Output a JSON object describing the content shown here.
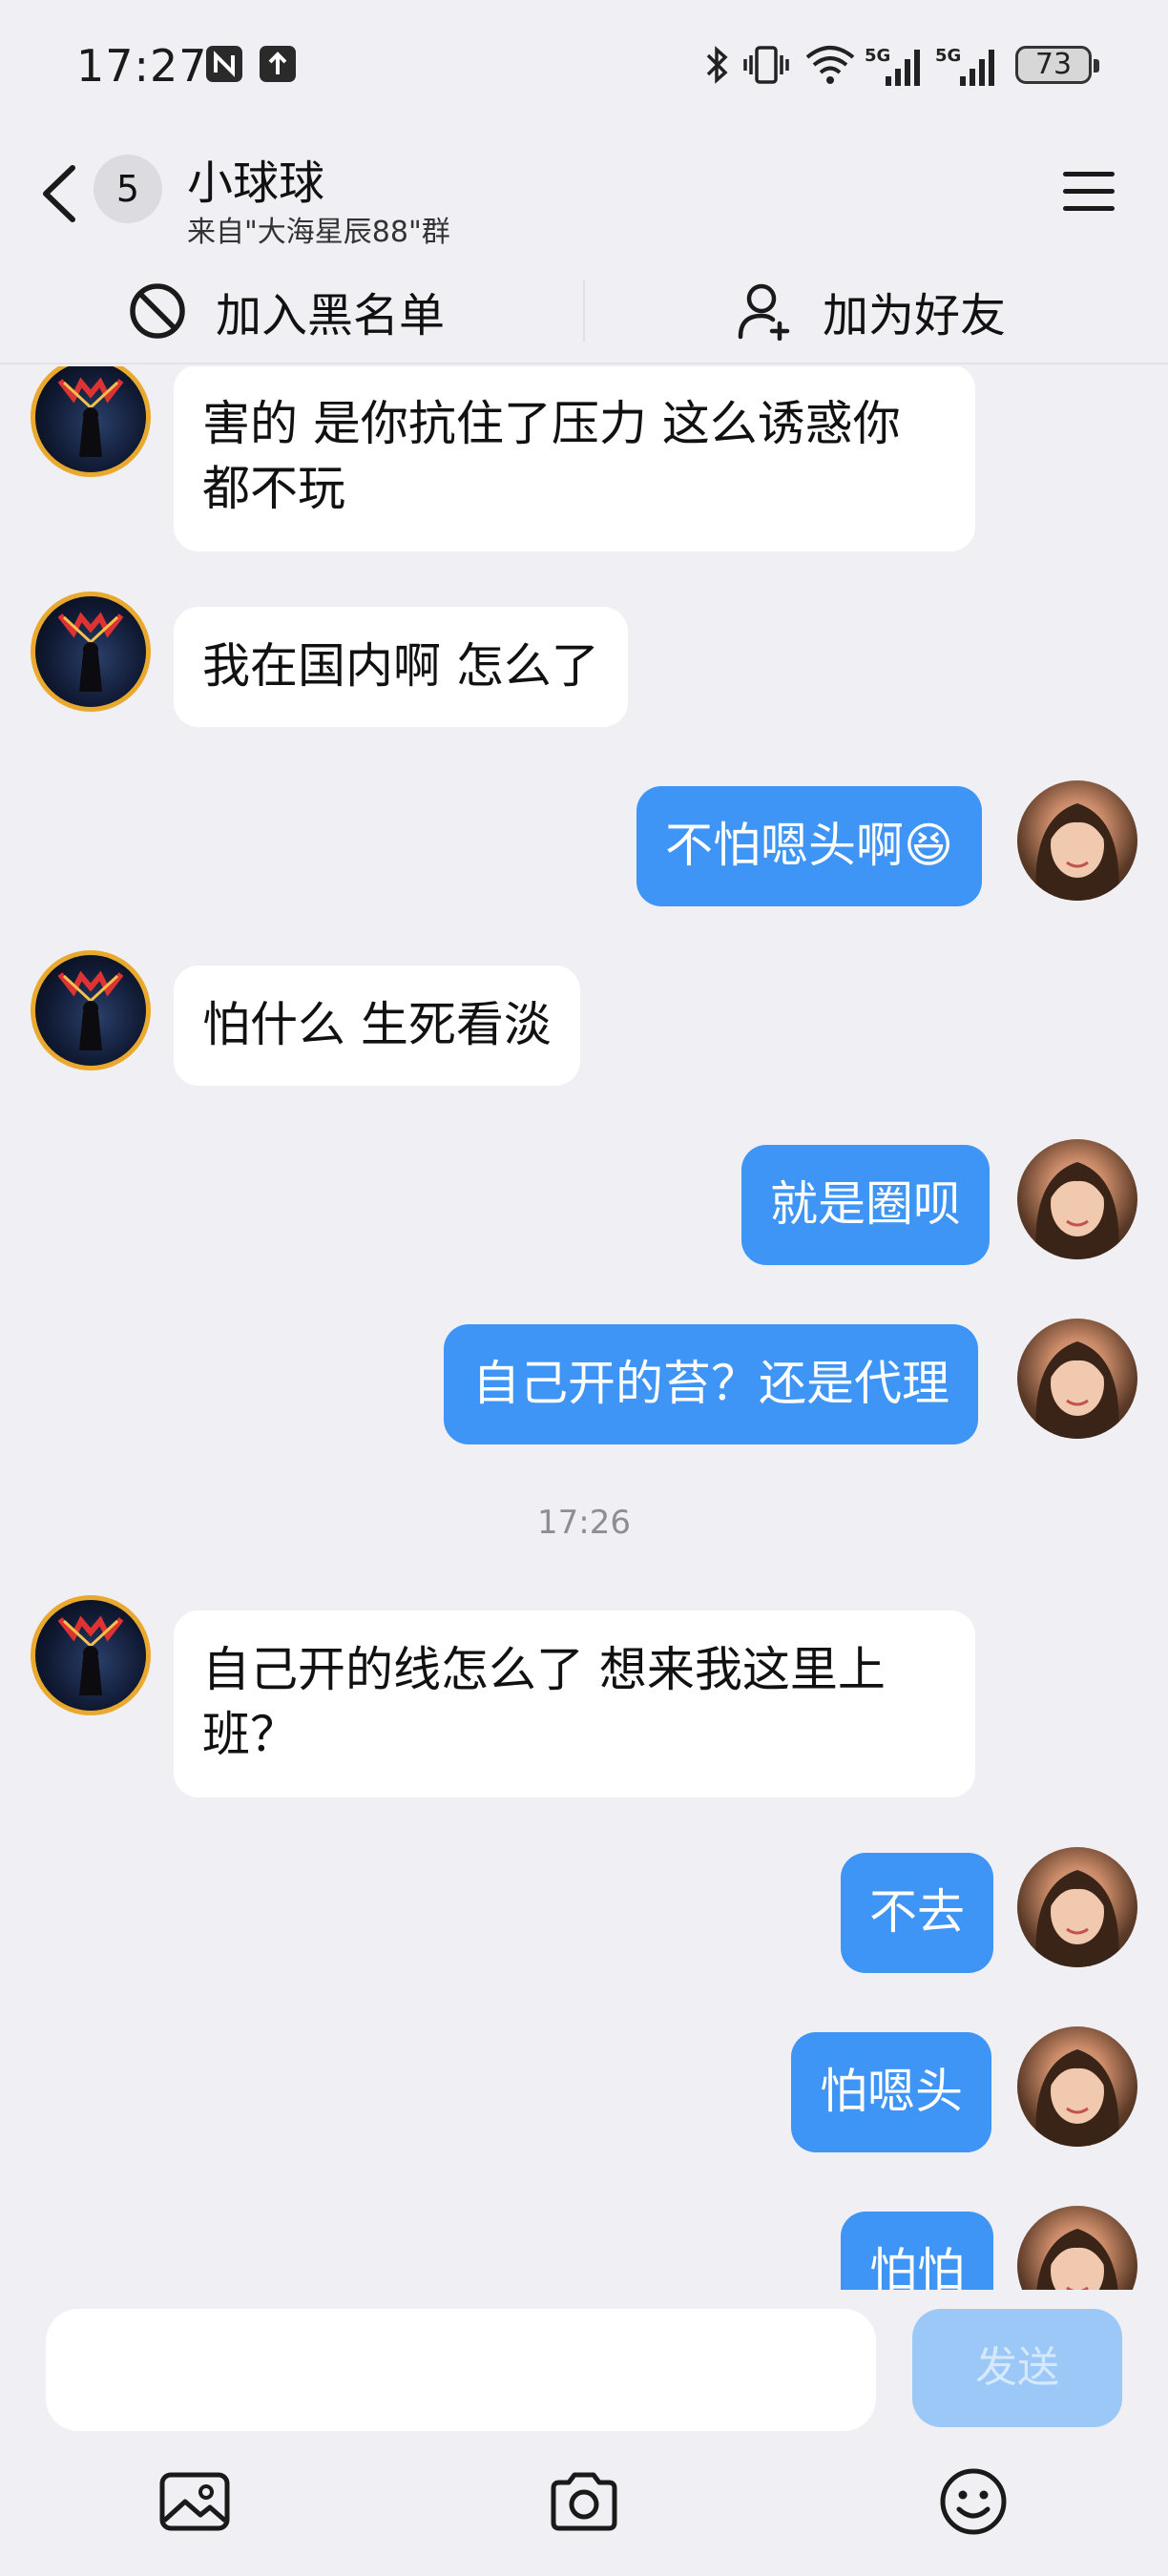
{
  "status_bar": {
    "time": "17:27",
    "battery": "73",
    "icons": [
      "nfc-icon",
      "upload-icon",
      "bluetooth-icon",
      "vibrate-icon",
      "wifi-icon",
      "signal-5g-icon",
      "signal-5g-icon"
    ]
  },
  "header": {
    "unread_count": "5",
    "contact_name": "小球球",
    "subtitle": "来自\"大海星辰88\"群"
  },
  "actions": {
    "block_label": "加入黑名单",
    "add_friend_label": "加为好友"
  },
  "messages": [
    {
      "side": "in",
      "text": "害的 是你抗住了压力 这么诱惑你都不玩"
    },
    {
      "side": "in",
      "text": "我在国内啊 怎么了"
    },
    {
      "side": "out",
      "text": "不怕嗯头啊",
      "emoji": "😆"
    },
    {
      "side": "in",
      "text": "怕什么 生死看淡"
    },
    {
      "side": "out",
      "text": "就是圈呗"
    },
    {
      "side": "out",
      "text": "自己开的苔？还是代理"
    },
    {
      "side": "in",
      "text": "自己开的线怎么了  想来我这里上班？"
    },
    {
      "side": "out",
      "text": "不去"
    },
    {
      "side": "out",
      "text": "怕嗯头"
    },
    {
      "side": "out",
      "text": "怕怕"
    }
  ],
  "time_divider": "17:26",
  "input": {
    "value": "",
    "placeholder": "",
    "send_label": "发送"
  },
  "toolbar": [
    "image-icon",
    "camera-icon",
    "emoji-icon"
  ],
  "colors": {
    "background": "#F0F0F4",
    "outgoing_bubble": "#3E95F5",
    "incoming_bubble": "#FFFFFF",
    "send_button_disabled": "#9CC8F7"
  }
}
